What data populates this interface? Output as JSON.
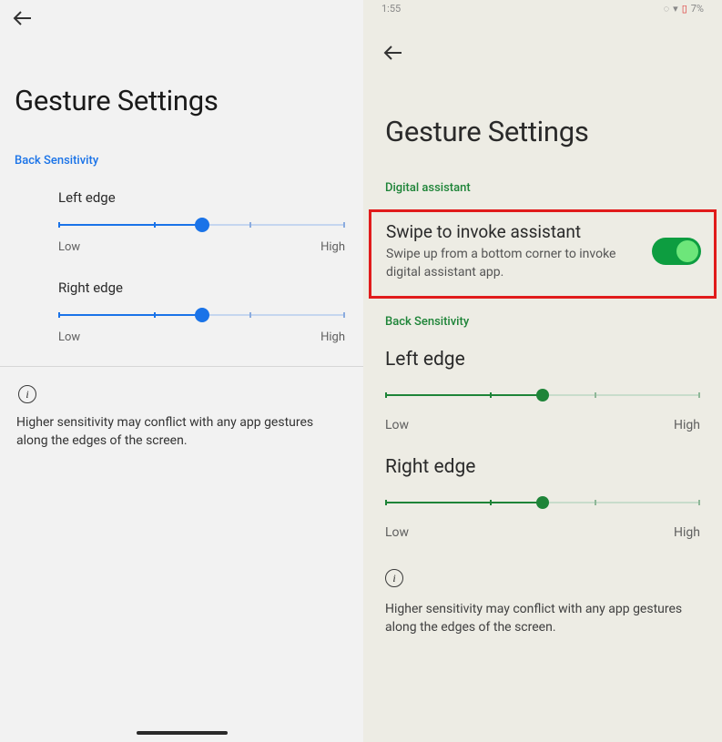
{
  "left": {
    "title": "Gesture Settings",
    "section": "Back Sensitivity",
    "sliders": {
      "left_edge": {
        "label": "Left edge",
        "min": "Low",
        "max": "High",
        "pct": 50
      },
      "right_edge": {
        "label": "Right edge",
        "min": "Low",
        "max": "High",
        "pct": 50
      }
    },
    "info": "Higher sensitivity may conflict with any app gestures along the edges of the screen.",
    "accent": "#1a73e8"
  },
  "right": {
    "status": {
      "time": "1:55",
      "battery": "7%"
    },
    "title": "Gesture Settings",
    "assistant_section": "Digital assistant",
    "assistant_toggle": {
      "title": "Swipe to invoke assistant",
      "desc": "Swipe up from a bottom corner to invoke digital assistant app.",
      "on": true
    },
    "back_section": "Back Sensitivity",
    "sliders": {
      "left_edge": {
        "label": "Left edge",
        "min": "Low",
        "max": "High",
        "pct": 50
      },
      "right_edge": {
        "label": "Right edge",
        "min": "Low",
        "max": "High",
        "pct": 50
      }
    },
    "info": "Higher sensitivity may conflict with any app gestures along the edges of the screen.",
    "accent": "#1e8438",
    "highlight_border": "#e11b1b"
  }
}
